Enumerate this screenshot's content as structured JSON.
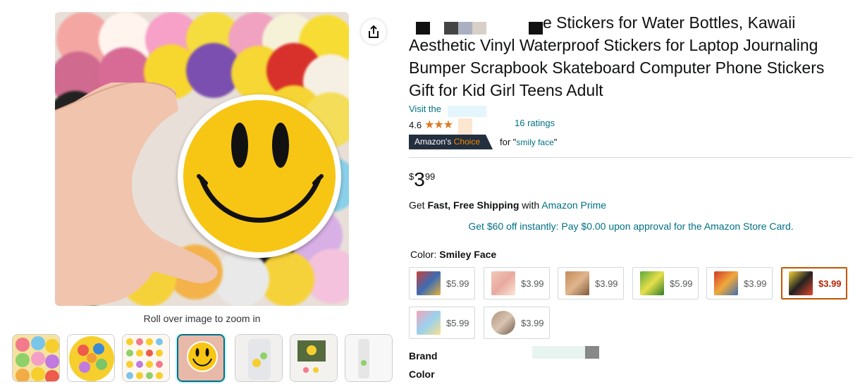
{
  "gallery": {
    "zoom_hint": "Roll over image to zoom in",
    "thumbnails": [
      "thumb-1",
      "thumb-2",
      "thumb-3",
      "thumb-4",
      "thumb-5",
      "thumb-6",
      "thumb-7"
    ],
    "selected_thumbnail": 4
  },
  "product": {
    "title": "e Stickers for Water Bottles, Kawaii Aesthetic Vinyl Waterproof Stickers for Laptop Journaling Bumper Scrapbook Skateboard Computer Phone Stickers Gift for Kid Girl Teens Adult",
    "visit_store": "Visit the",
    "rating_value": "4.6",
    "ratings_count": "16 ratings",
    "choice_label_1": "Amazon's",
    "choice_label_2": "Choice",
    "choice_for": "for \"",
    "choice_keyword": "smily face",
    "choice_close": "\"",
    "price": {
      "symbol": "$",
      "whole": "3",
      "fraction": "99"
    },
    "shipping_prefix": "Get ",
    "shipping_bold": "Fast, Free Shipping",
    "shipping_mid": " with ",
    "shipping_link": "Amazon Prime",
    "store_card": "Get $60 off instantly: Pay $0.00 upon approval for the Amazon Store Card.",
    "color_label": "Color: ",
    "color_value": "Smiley Face",
    "swatches": [
      {
        "price": "$5.99",
        "colors": [
          "#c9423c",
          "#3d6bb3",
          "#e5b13b"
        ]
      },
      {
        "price": "$3.99",
        "colors": [
          "#f2c9b8",
          "#e8a9a0",
          "#fbe6d6"
        ]
      },
      {
        "price": "$3.99",
        "colors": [
          "#c48a5a",
          "#e0b68d",
          "#7e5a3c"
        ]
      },
      {
        "price": "$5.99",
        "colors": [
          "#5ea73a",
          "#e7e04a",
          "#2f7d2a"
        ]
      },
      {
        "price": "$3.99",
        "colors": [
          "#d33a2a",
          "#f0a93c",
          "#3f6fb0"
        ]
      },
      {
        "price": "$3.99",
        "colors": [
          "#f6d23a",
          "#222222",
          "#e8452c"
        ],
        "selected": true
      },
      {
        "price": "$5.99",
        "colors": [
          "#f4a6b8",
          "#9ad1f0",
          "#f7e08a"
        ]
      },
      {
        "price": "$3.99",
        "colors": [
          "#b09480",
          "#d8c4b0",
          "#6e5a4c"
        ]
      }
    ],
    "brand_label": "Brand",
    "color_spec_label": "Color"
  },
  "colors": {
    "link": "#007185",
    "star": "#de7921",
    "choice_bg": "#232f3e",
    "choice_accent": "#f08804",
    "selected_border": "#c45500"
  }
}
